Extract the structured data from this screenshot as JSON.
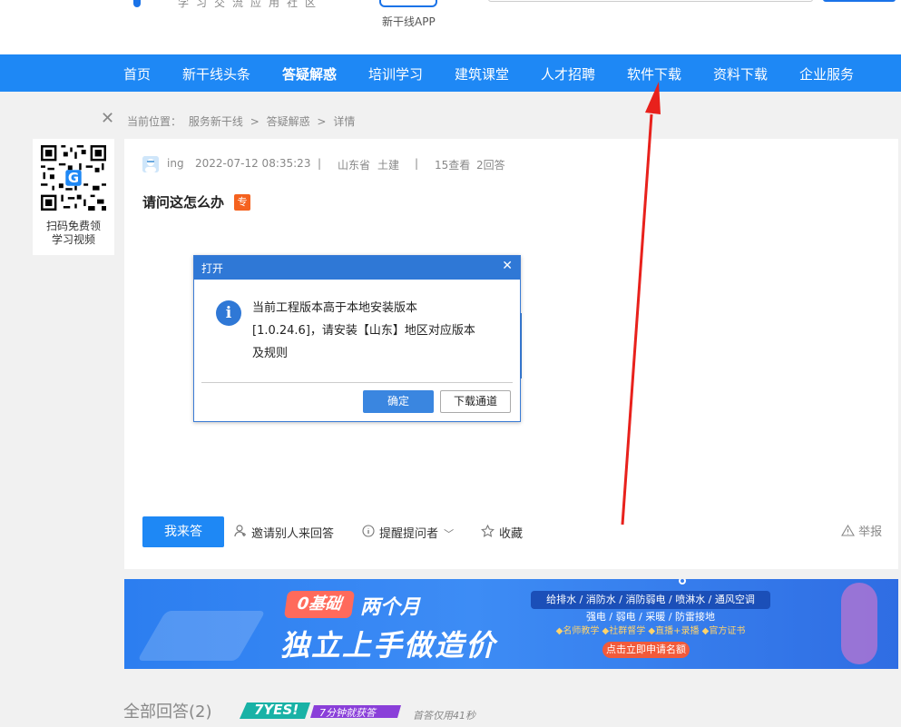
{
  "header": {
    "slogan": "学习交流应用社区",
    "app_label": "新干线APP"
  },
  "nav": {
    "items": [
      {
        "label": "首页"
      },
      {
        "label": "新干线头条"
      },
      {
        "label": "答疑解惑"
      },
      {
        "label": "培训学习"
      },
      {
        "label": "建筑课堂"
      },
      {
        "label": "人才招聘"
      },
      {
        "label": "软件下载"
      },
      {
        "label": "资料下载"
      },
      {
        "label": "企业服务"
      }
    ],
    "active_index": 2
  },
  "breadcrumb": {
    "prefix": "当前位置：",
    "items": [
      "服务新干线",
      "答疑解惑",
      "详情"
    ],
    "separator": ">"
  },
  "qr_card": {
    "line1": "扫码免费领",
    "line2": "学习视频"
  },
  "question": {
    "user": "ing",
    "datetime": "2022-07-12 08:35:23",
    "region": "山东省",
    "category": "土建",
    "views": "15查看",
    "answers": "2回答",
    "title": "请问这怎么办",
    "tag": "专"
  },
  "actions": {
    "answer_button": "我来答",
    "invite": "邀请别人来回答",
    "remind": "提醒提问者",
    "favorite": "收藏",
    "report": "举报"
  },
  "dialog": {
    "title": "打开",
    "line1": "当前工程版本高于本地安装版本",
    "line2": "[1.0.24.6]，请安装【山东】地区对应版本",
    "line3": "及规则",
    "ok_label": "确定",
    "download_label": "下载通道"
  },
  "banner": {
    "tag": "0基础",
    "months": "两个月",
    "headline": "独立上手做造价",
    "line1": "给排水 / 消防水 / 消防弱电 / 喷淋水 / 通风空调",
    "line2": "强电 / 弱电 / 采暖 / 防雷接地",
    "line3": "◆名师教学 ◆社群督学 ◆直播+录播 ◆官方证书",
    "cta": "点击立即申请名额"
  },
  "answers_section": {
    "title": "全部回答(2)",
    "badge_yes": "7YES!",
    "badge_sub": "7分钟就获答",
    "first_answer": "首答仅用41秒"
  },
  "colors": {
    "nav_bg": "#1e88f5",
    "accent": "#1e88f5",
    "dialog_header": "#2f78d6",
    "annotation_arrow": "#e8211c",
    "tag_orange": "#f5621f"
  }
}
